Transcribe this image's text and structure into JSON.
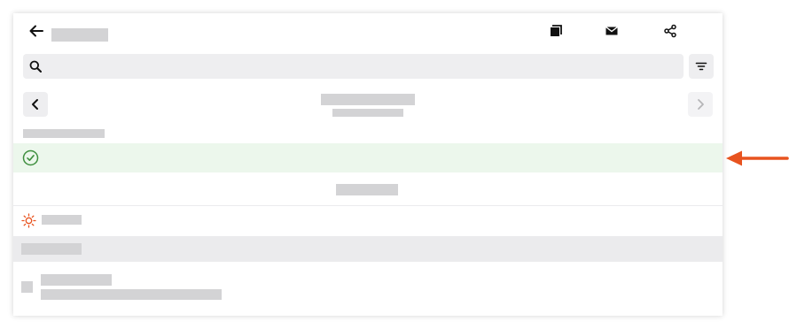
{
  "header": {
    "back_icon": "arrow-left-icon",
    "actions": [
      {
        "name": "copy-button",
        "icon": "copy-icon"
      },
      {
        "name": "email-button",
        "icon": "mail-icon"
      },
      {
        "name": "share-button",
        "icon": "share-icon"
      }
    ]
  },
  "search": {
    "icon": "search-icon",
    "value": "",
    "placeholder": ""
  },
  "filter": {
    "icon": "filter-icon"
  },
  "date_nav": {
    "prev_icon": "chevron-left-icon",
    "next_icon": "chevron-right-icon",
    "next_enabled": false
  },
  "status_row": {
    "icon": "check-circle-icon",
    "state": "success"
  },
  "weather_row": {
    "icon": "sun-icon"
  },
  "annotation": {
    "icon": "arrow-left-icon",
    "color": "#e8531f"
  },
  "colors": {
    "accent": "#e8531f",
    "success": "#3f8f3f",
    "success_bg": "#ecf7ec",
    "placeholder_bar": "#d3d3d5",
    "band": "#ebebed"
  }
}
